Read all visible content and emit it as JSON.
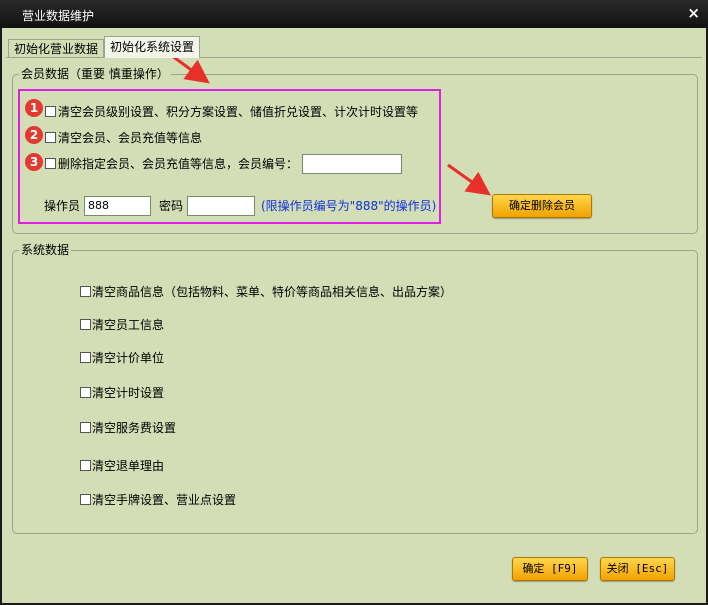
{
  "window": {
    "title": "营业数据维护",
    "close_glyph": "×"
  },
  "tabs": [
    {
      "label": "初始化营业数据",
      "active": false
    },
    {
      "label": "初始化系统设置",
      "active": true
    }
  ],
  "member_group": {
    "legend": "会员数据（重要 慎重操作）",
    "options": [
      {
        "badge": "1",
        "label": "清空会员级别设置、积分方案设置、储值折兑设置、计次计时设置等",
        "checked": false
      },
      {
        "badge": "2",
        "label": "清空会员、会员充值等信息",
        "checked": false
      },
      {
        "badge": "3",
        "label": "删除指定会员、会员充值等信息，会员编号：",
        "checked": false
      }
    ],
    "member_no_value": "",
    "operator_label": "操作员",
    "operator_value": "888",
    "password_label": "密码",
    "password_value": "",
    "hint": "(限操作员编号为\"888\"的操作员)",
    "confirm_delete_button": "确定删除会员"
  },
  "system_group": {
    "legend": "系统数据",
    "options": [
      {
        "label": "清空商品信息（包括物料、菜单、特价等商品相关信息、出品方案）",
        "checked": false
      },
      {
        "label": "清空员工信息",
        "checked": false
      },
      {
        "label": "清空计价单位",
        "checked": false
      },
      {
        "label": "清空计时设置",
        "checked": false
      },
      {
        "label": "清空服务费设置",
        "checked": false
      },
      {
        "label": "清空退单理由",
        "checked": false
      },
      {
        "label": "清空手牌设置、营业点设置",
        "checked": false
      }
    ]
  },
  "footer": {
    "ok_button": "确定 [F9]",
    "close_button": "关闭 [Esc]"
  },
  "colors": {
    "background": "#d3ddb6",
    "annotation": "#e020e0",
    "arrow": "#e8302a",
    "hint": "#1030e0",
    "button": "#f2a200"
  }
}
